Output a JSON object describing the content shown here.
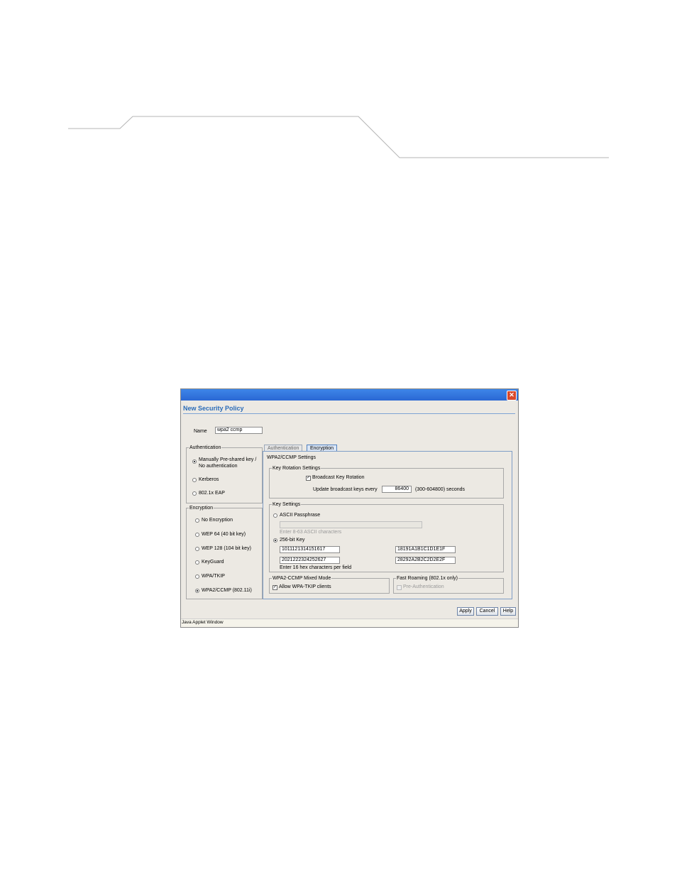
{
  "dialog": {
    "title": "New Security Policy",
    "name_label": "Name",
    "name_value": "wpa2 ccmp",
    "status_bar": "Java Applet Window"
  },
  "authentication_group": {
    "title": "Authentication",
    "options": [
      {
        "label_line1": "Manually Pre-shared key /",
        "label_line2": "No authentication",
        "selected": true
      },
      {
        "label": "Kerberos",
        "selected": false
      },
      {
        "label": "802.1x EAP",
        "selected": false
      }
    ]
  },
  "encryption_group": {
    "title": "Encryption",
    "options": [
      {
        "label": "No Encryption",
        "selected": false
      },
      {
        "label": "WEP 64 (40 bit key)",
        "selected": false
      },
      {
        "label": "WEP 128 (104 bit key)",
        "selected": false
      },
      {
        "label": "KeyGuard",
        "selected": false
      },
      {
        "label": "WPA/TKIP",
        "selected": false
      },
      {
        "label": "WPA2/CCMP (802.11i)",
        "selected": true
      }
    ]
  },
  "tabs": [
    {
      "label": "Authentication",
      "active": false
    },
    {
      "label": "Encryption",
      "active": true
    }
  ],
  "wpa2_settings": {
    "title": "WPA2/CCMP Settings",
    "key_rotation": {
      "title": "Key Rotation Settings",
      "broadcast_label": "Broadcast Key Rotation",
      "broadcast_checked": true,
      "update_label": "Update broadcast keys every",
      "update_value": "86400",
      "update_range": "(300-604800) seconds"
    },
    "key_settings": {
      "title": "Key Settings",
      "ascii_label": "ASCII Passphrase",
      "ascii_value": "",
      "ascii_hint": "Enter 8-63 ASCII characters",
      "hex_label": "256-bit Key",
      "hex_selected": true,
      "keys": [
        "1011121314151617",
        "18191A1B1C1D1E1F",
        "2021222324252627",
        "28292A2B2C2D2E2F"
      ],
      "hex_hint": "Enter 16 hex characters per field"
    },
    "mixed_mode": {
      "title": "WPA2-CCMP Mixed Mode",
      "allow_label": "Allow WPA-TKIP clients",
      "allow_checked": true
    },
    "fast_roaming": {
      "title": "Fast Roaming (802.1x only)",
      "preauth_label": "Pre-Authentication",
      "preauth_checked": false
    }
  },
  "buttons": {
    "apply": "Apply",
    "cancel": "Cancel",
    "help": "Help"
  },
  "colors": {
    "titlebar": "#2a67d4",
    "dialog_title": "#2b6cb8",
    "close": "#d9482b"
  }
}
